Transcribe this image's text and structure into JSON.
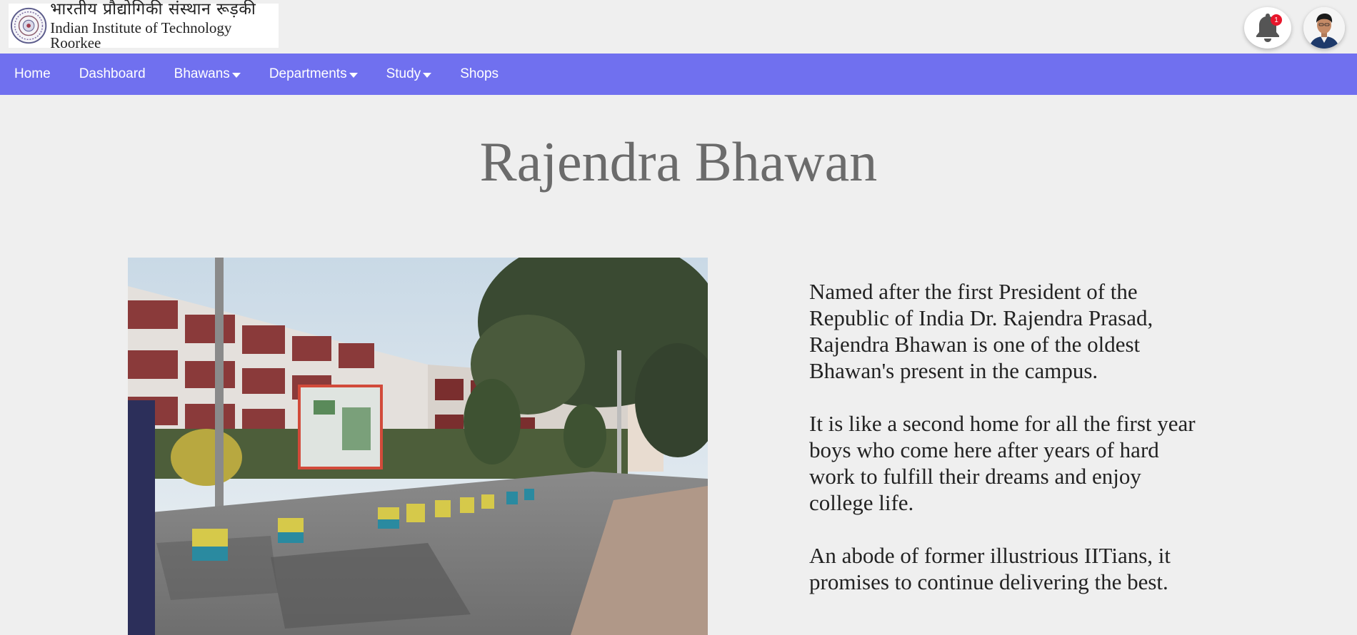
{
  "header": {
    "logo": {
      "hindi_text": "भारतीय प्रौद्योगिकी संस्थान रूड़की",
      "english_text": "Indian Institute of Technology Roorkee"
    },
    "notifications": {
      "icon": "bell-icon",
      "badge_count": "1"
    },
    "avatar": {
      "icon": "user-avatar"
    }
  },
  "nav": {
    "items": [
      {
        "label": "Home",
        "dropdown": false
      },
      {
        "label": "Dashboard",
        "dropdown": false
      },
      {
        "label": "Bhawans",
        "dropdown": true
      },
      {
        "label": "Departments",
        "dropdown": true
      },
      {
        "label": "Study",
        "dropdown": true
      },
      {
        "label": "Shops",
        "dropdown": false
      }
    ]
  },
  "main": {
    "title": "Rajendra Bhawan",
    "paragraphs": [
      "Named after the first President of the Republic of India Dr. Rajendra Prasad, Rajendra Bhawan is one of the oldest Bhawan's present in the campus.",
      "It is like a second home for all the first year boys who come here after years of hard work to fulfill their dreams and enjoy college life.",
      "An abode of former illustrious IITians, it promises to continue delivering the best."
    ]
  },
  "colors": {
    "background": "#efefef",
    "navbar": "#7070ef",
    "title": "#6b6b6b",
    "badge": "#e8162b"
  }
}
